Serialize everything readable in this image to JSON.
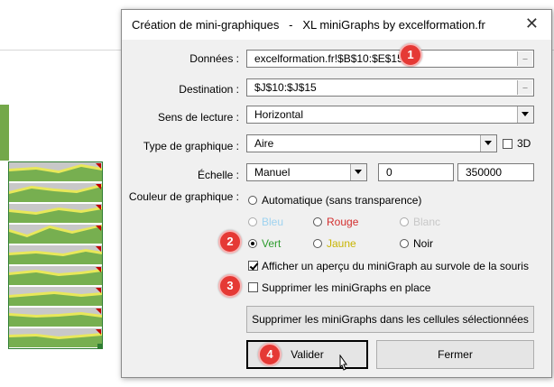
{
  "dialog": {
    "title": "Création de mini-graphiques   -   XL miniGraphs by excelformation.fr",
    "close_glyph": "✕"
  },
  "fields": {
    "donnees_label": "Données :",
    "donnees_value": "excelformation.fr!$B$10:$E$15",
    "destination_label": "Destination :",
    "destination_value": "$J$10:$J$15",
    "sens_label": "Sens de lecture :",
    "sens_value": "Horizontal",
    "type_label": "Type de graphique :",
    "type_value": "Aire",
    "type_3d_label": "3D",
    "echelle_label": "Échelle :",
    "echelle_mode": "Manuel",
    "echelle_min": "0",
    "echelle_max": "350000",
    "ref_btn_glyph": "_"
  },
  "colors": {
    "section_label": "Couleur de graphique :",
    "automatique": "Automatique (sans transparence)",
    "bleu": "Bleu",
    "rouge": "Rouge",
    "blanc": "Blanc",
    "vert": "Vert",
    "jaune": "Jaune",
    "noir": "Noir",
    "selected": "Vert",
    "bleu_color": "#9fd3f0",
    "rouge_color": "#d32f2f",
    "blanc_color": "#c8c8c8",
    "vert_color": "#2e9c2e",
    "jaune_color": "#c8b400",
    "noir_color": "#000000"
  },
  "options": {
    "apercu_label": "Afficher un aperçu du miniGraph au survole de la souris",
    "apercu_checked": true,
    "supprimer_label": "Supprimer les miniGraphs en place",
    "supprimer_checked": false
  },
  "buttons": {
    "supprimer_selection": "Supprimer les miniGraphs dans les cellules sélectionnées",
    "valider": "Valider",
    "fermer": "Fermer"
  },
  "badges": [
    "1",
    "2",
    "3",
    "4"
  ],
  "accent": "#e53935"
}
